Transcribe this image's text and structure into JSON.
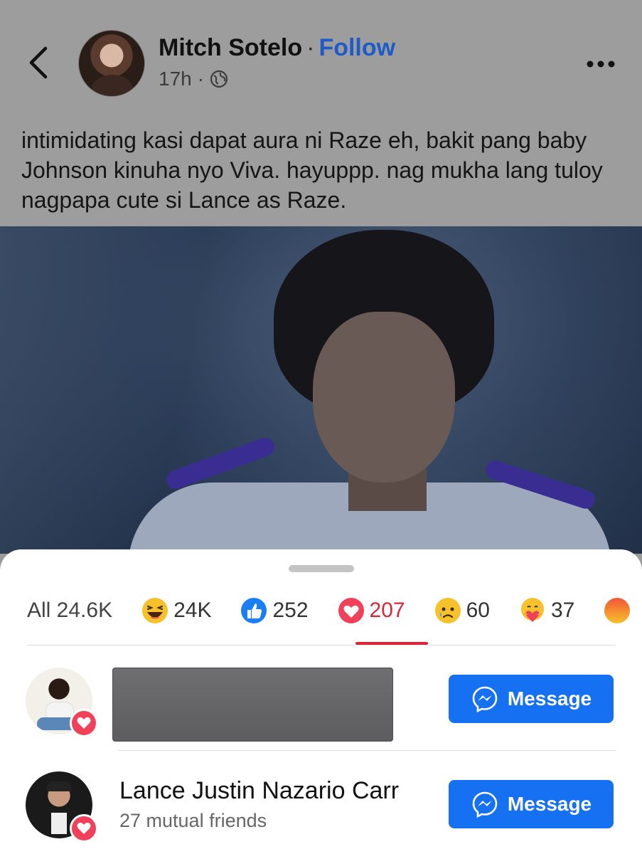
{
  "post": {
    "author_name": "Mitch Sotelo",
    "separator": "·",
    "follow_label": "Follow",
    "timestamp": "17h",
    "meta_dot": "·",
    "text": "intimidating kasi dapat aura ni Raze eh, bakit pang baby Johnson kinuha nyo Viva. hayuppp. nag mukha lang tuloy nagpapa cute si Lance as Raze."
  },
  "reactions": {
    "tabs": [
      {
        "label": "All 24.6K",
        "icon": null
      },
      {
        "label": "24K",
        "icon": "haha-icon"
      },
      {
        "label": "252",
        "icon": "like-icon"
      },
      {
        "label": "207",
        "icon": "love-icon",
        "active": true
      },
      {
        "label": "60",
        "icon": "sad-icon"
      },
      {
        "label": "37",
        "icon": "care-icon"
      }
    ],
    "people": [
      {
        "name": "",
        "redacted": true,
        "button_label": "Message",
        "reaction": "love-icon"
      },
      {
        "name": "Lance Justin Nazario Carr",
        "subtitle": "27 mutual friends",
        "button_label": "Message",
        "reaction": "love-icon"
      }
    ]
  },
  "colors": {
    "accent_blue": "#1671f2",
    "follow_blue": "#1d5cc8",
    "love_red": "#d8263a",
    "overlay_gray": "#9d9d9d"
  }
}
